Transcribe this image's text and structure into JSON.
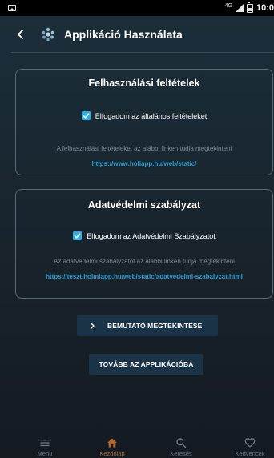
{
  "status_bar": {
    "network": "4G",
    "time": "10:0"
  },
  "header": {
    "title": "Applikáció Használata"
  },
  "terms": {
    "title": "Felhasználási feltételek",
    "checkbox_label": "Elfogadom az általános feltételeket",
    "checked": true,
    "description": "A felhasználási feltételeket az alábbi linken tudja megtekinteni",
    "link": "https://www.holiapp.hu/web/static/"
  },
  "privacy": {
    "title": "Adatvédelmi szabályzat",
    "checkbox_label": "Elfogadom az Adatvédelmi Szabályzatot",
    "checked": true,
    "description": "Az adatvédelmi szabályzatot az alábbi linken tudja megtekinteni",
    "link": "https://teszt.holmiapp.hu/web/static/adatvedelmi-szabalyzat.html"
  },
  "buttons": {
    "demo_label": "BEMUTATÓ MEGTEKINTÉSE",
    "continue_label": "TOVÁBB AZ APPLIKÁCIÓBA"
  },
  "bottom_nav": {
    "items": [
      {
        "label": "Menü",
        "icon": "menu-icon",
        "active": false
      },
      {
        "label": "Kezdőlap",
        "icon": "home-icon",
        "active": true
      },
      {
        "label": "Keresés",
        "icon": "search-icon",
        "active": false
      },
      {
        "label": "Kedvencek",
        "icon": "heart-icon",
        "active": false
      }
    ]
  },
  "colors": {
    "accent": "#2eaee0",
    "link": "#2e9fd0",
    "active_nav": "#b36a2c",
    "button_bg": "#1a3346"
  }
}
